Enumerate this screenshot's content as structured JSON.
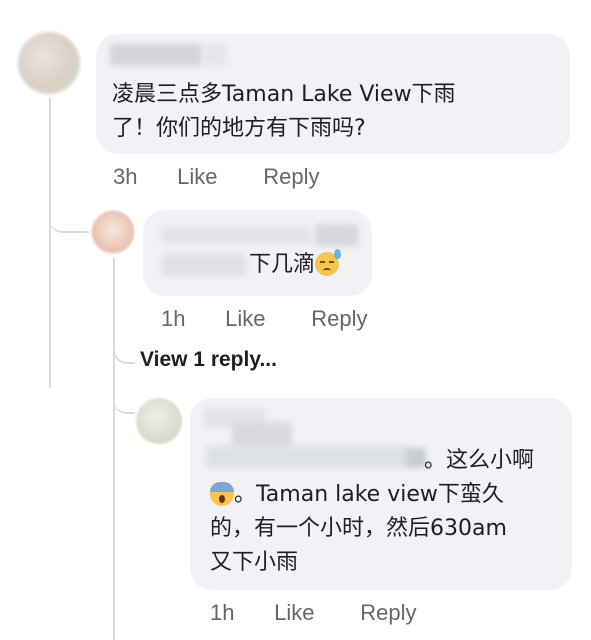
{
  "thread": {
    "comment1": {
      "line1": "凌晨三点多Taman Lake View下雨",
      "line2": "了！你们的地方有下雨吗?",
      "time": "3h",
      "like": "Like",
      "reply": "Reply"
    },
    "reply1": {
      "text": "下几滴",
      "emoji": "downcast-sweat-emoji",
      "time": "1h",
      "like": "Like",
      "reply": "Reply"
    },
    "view_replies": "View 1 reply...",
    "reply2": {
      "line1": "。这么小啊",
      "line2": "。Taman lake view下蛮久",
      "line3": "的，有一个小时，然后630am",
      "line4": "又下小雨",
      "emoji": "screaming-face-emoji",
      "time": "1h",
      "like": "Like",
      "reply": "Reply"
    }
  },
  "colors": {
    "bubble": "#f0f2f5",
    "meta_text": "#65676b",
    "thread_line": "#d9dadc"
  }
}
